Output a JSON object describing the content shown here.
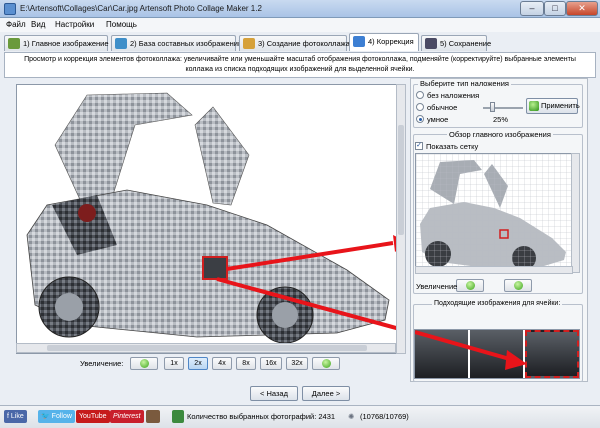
{
  "window": {
    "title": "E:\\Artensoft\\Collages\\Car\\Car.jpg Artensoft Photo Collage Maker 1.2",
    "controls": {
      "minimize": "–",
      "maximize": "□",
      "close": "✕"
    }
  },
  "menu": [
    "Файл",
    "Вид",
    "Настройки",
    "Помощь"
  ],
  "tabs": [
    {
      "label": "1) Главное изображение"
    },
    {
      "label": "2) База составных изображений"
    },
    {
      "label": "3) Создание фотоколлажа"
    },
    {
      "label": "4) Коррекция"
    },
    {
      "label": "5) Сохранение"
    }
  ],
  "instruction": {
    "line1": "Просмотр и коррекция элементов фотоколлажа: увеличивайте или уменьшайте масштаб отображения фотоколлажа, подменяйте (корректируйте) выбранные элементы",
    "line2": "коллажа из списка подходящих изображений для выделенной ячейки."
  },
  "zoom": {
    "label": "Увеличение:",
    "levels": [
      "1x",
      "2x",
      "4x",
      "8x",
      "16x",
      "32x"
    ],
    "selected": "2x"
  },
  "nav": {
    "back": "< Назад",
    "next": "Далее >"
  },
  "overlay": {
    "title": "Выберите тип наложения",
    "options": [
      "без наложения",
      "обычное",
      "умное"
    ],
    "selected": "умное",
    "percent": "25%",
    "level": 0.25,
    "apply": "Применить"
  },
  "overview": {
    "title": "Обзор главного изображения",
    "show_grid": "Показать сетку",
    "zoom_label": "Увеличение"
  },
  "cells": {
    "title": "Подходящие изображения для ячейки:"
  },
  "status": {
    "like": "Like",
    "follow": "Follow",
    "youtube": "YouTube",
    "pinterest": "Pinterest",
    "selected_photos": "Количество выбранных фотографий: 2431",
    "progress": "(10768/10769)"
  },
  "colors": {
    "arrow": "#e8141a",
    "accent": "#3aa31a",
    "selection": "#d11f1f"
  }
}
